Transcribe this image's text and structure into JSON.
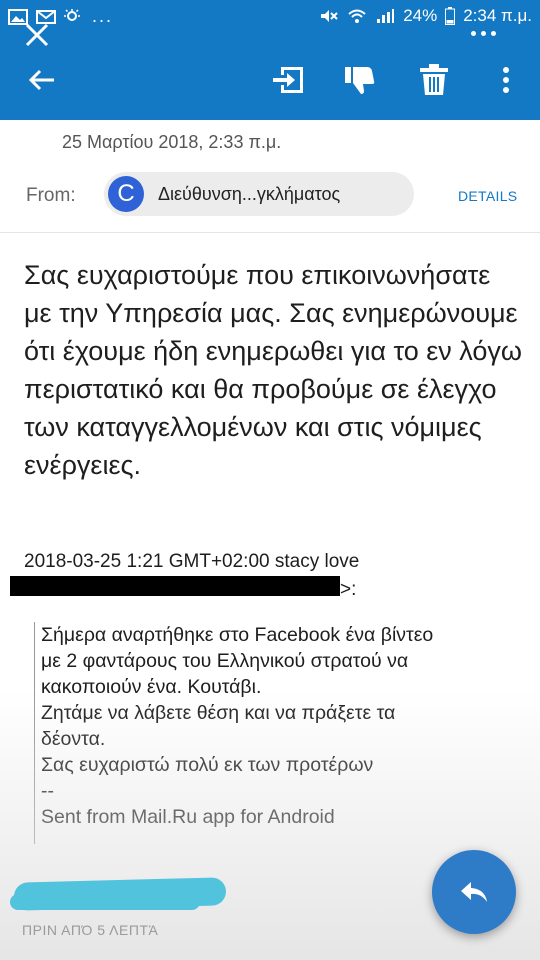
{
  "status_bar": {
    "battery": "24%",
    "time": "2:34 π.μ.",
    "icons": [
      "image-icon",
      "mail-icon",
      "weather-icon",
      "more-notifications-icon",
      "mute-icon",
      "wifi-icon",
      "signal-icon",
      "battery-icon"
    ]
  },
  "toolbar": {
    "icons": [
      "back-arrow-icon",
      "move-to-icon",
      "spam-icon",
      "delete-icon",
      "overflow-menu-icon"
    ]
  },
  "header": {
    "date": "25 Μαρτίου 2018, 2:33 π.μ.",
    "from_label": "From:",
    "sender_initial": "C",
    "sender_name": "Διεύθυνση...γκλήματος",
    "details_label": "DETAILS"
  },
  "body": {
    "reply_text": "Σας ευχαριστούμε που επικοινωνήσατε με την Υπηρεσία μας. Σας ενημερώνουμε ότι έχουμε ήδη ενημερωθει για το εν λόγω περιστατικό και θα προβούμε σε έλεγχο των καταγγελλομένων και στις νόμιμες ενέργειες.",
    "quote_header": "2018-03-25 1:21 GMT+02:00 stacy love",
    "email_visible_tail": ">:",
    "quoted_lines": [
      "Σήμερα αναρτήθηκε στο Facebook ένα βίντεο",
      "με 2 φαντάρους του Ελληνικού στρατού να",
      "κακοποιούν ένα. Κουτάβι.",
      "Ζητάμε να λάβετε θέση και να πράξετε τα",
      "δέοντα.",
      "Σας ευχαριστώ πολύ εκ των προτέρων",
      "--",
      "Sent from Mail.Ru app for Android"
    ]
  },
  "footer": {
    "time_ago": "ΠΡΙΝ ΑΠΌ 5 ΛΕΠΤΆ",
    "fab_icon": "reply-icon"
  },
  "colors": {
    "appbar": "#1479c4",
    "accent": "#1479c4",
    "avatar": "#2f62d7",
    "fab": "#2e7bc8",
    "redaction": "#52c3dd"
  }
}
